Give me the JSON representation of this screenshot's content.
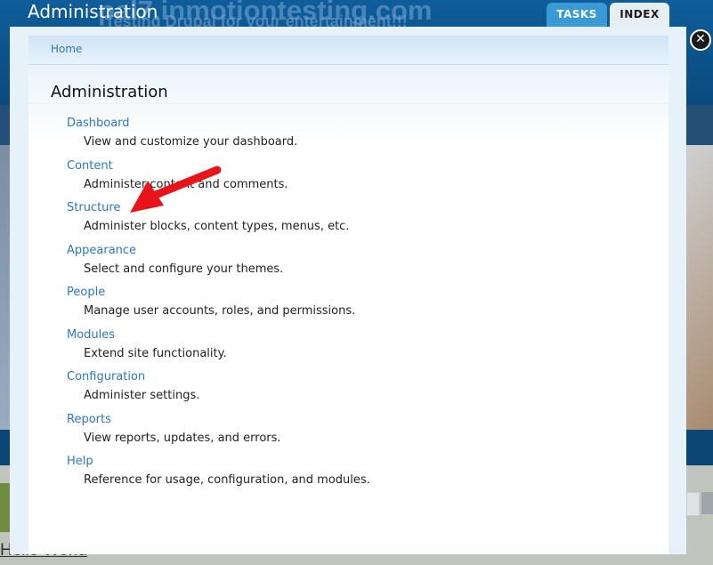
{
  "background_site": {
    "site_title": "pal7.inmotiontesting.com",
    "slogan": "Testing Drupal for your entertainment!!!",
    "hello_text": "Hello World"
  },
  "overlay": {
    "title": "Administration",
    "tabs": [
      {
        "label": "TASKS",
        "active": true
      },
      {
        "label": "INDEX",
        "active": false
      }
    ],
    "close_icon": "close-icon"
  },
  "breadcrumb": {
    "home": "Home"
  },
  "page": {
    "title": "Administration",
    "items": [
      {
        "label": "Dashboard",
        "description": "View and customize your dashboard."
      },
      {
        "label": "Content",
        "description": "Administer content and comments."
      },
      {
        "label": "Structure",
        "description": "Administer blocks, content types, menus, etc."
      },
      {
        "label": "Appearance",
        "description": "Select and configure your themes."
      },
      {
        "label": "People",
        "description": "Manage user accounts, roles, and permissions."
      },
      {
        "label": "Modules",
        "description": "Extend site functionality."
      },
      {
        "label": "Configuration",
        "description": "Administer settings."
      },
      {
        "label": "Reports",
        "description": "View reports, updates, and errors."
      },
      {
        "label": "Help",
        "description": "Reference for usage, configuration, and modules."
      }
    ]
  },
  "colors": {
    "link": "#2c78c1",
    "tab_active": "#3a9ad6",
    "header_bg": "#0f5d9a",
    "annotation_arrow": "#e8141a"
  }
}
